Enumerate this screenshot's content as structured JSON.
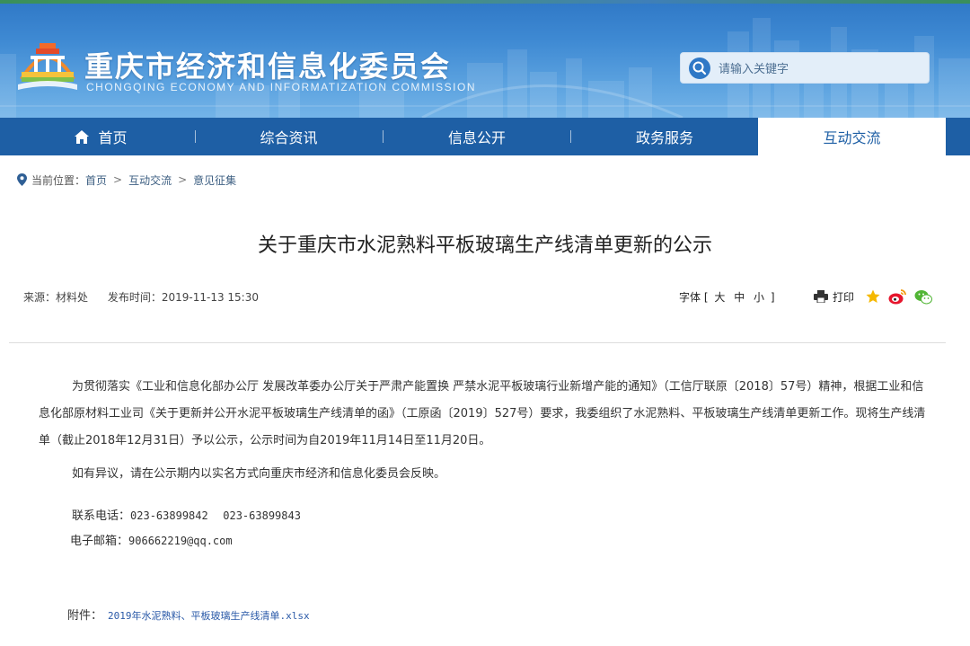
{
  "header": {
    "site_title": "重庆市经济和信息化委员会",
    "site_subtitle": "CHONGQING ECONOMY AND INFORMATIZATION COMMISSION",
    "search_placeholder": "请输入关键字"
  },
  "nav": {
    "items": [
      {
        "label": "首页",
        "active": false
      },
      {
        "label": "综合资讯",
        "active": false
      },
      {
        "label": "信息公开",
        "active": false
      },
      {
        "label": "政务服务",
        "active": false
      },
      {
        "label": "互动交流",
        "active": true
      }
    ]
  },
  "breadcrumb": {
    "prefix": "当前位置：",
    "items": [
      "首页",
      "互动交流",
      "意见征集"
    ],
    "separator": ">"
  },
  "article": {
    "title": "关于重庆市水泥熟料平板玻璃生产线清单更新的公示",
    "source": "来源：材料处",
    "publish_time": "发布时间：2019-11-13 15:30",
    "font_size_label": "字体",
    "font_size_open": "[",
    "font_size_close": "]",
    "font_size_options": [
      "大",
      "中",
      "小"
    ],
    "print_label": "打印",
    "paragraph_1": "为贯彻落实《工业和信息化部办公厅 发展改革委办公厅关于严肃产能置换 严禁水泥平板玻璃行业新增产能的通知》（工信厅联原〔2018〕57号）精神，根据工业和信息化部原材料工业司《关于更新并公开水泥平板玻璃生产线清单的函》（工原函〔2019〕527号）要求，我委组织了水泥熟料、平板玻璃生产线清单更新工作。现将生产线清单（截止2018年12月31日）予以公示，公示时间为自2019年11月14日至11月20日。",
    "paragraph_2": "如有异议，请在公示期内以实名方式向重庆市经济和信息化委员会反映。",
    "phone_label": "联系电话：",
    "phone_1": "023-63899842",
    "phone_2": "023-63899843",
    "email_label": "电子邮箱：",
    "email": "906662219@qq.com",
    "attachment_label": "附件：",
    "attachment_file": "2019年水泥熟料、平板玻璃生产线清单.xlsx"
  },
  "colors": {
    "nav_bg": "#1e5fa5",
    "banner_blue": "#3f8ad3",
    "link": "#2b5aa8"
  },
  "icons": [
    "logo-emblem-icon",
    "search-icon",
    "home-icon",
    "location-pin-icon",
    "print-icon",
    "favorite-star-icon",
    "weibo-icon",
    "wechat-icon"
  ]
}
